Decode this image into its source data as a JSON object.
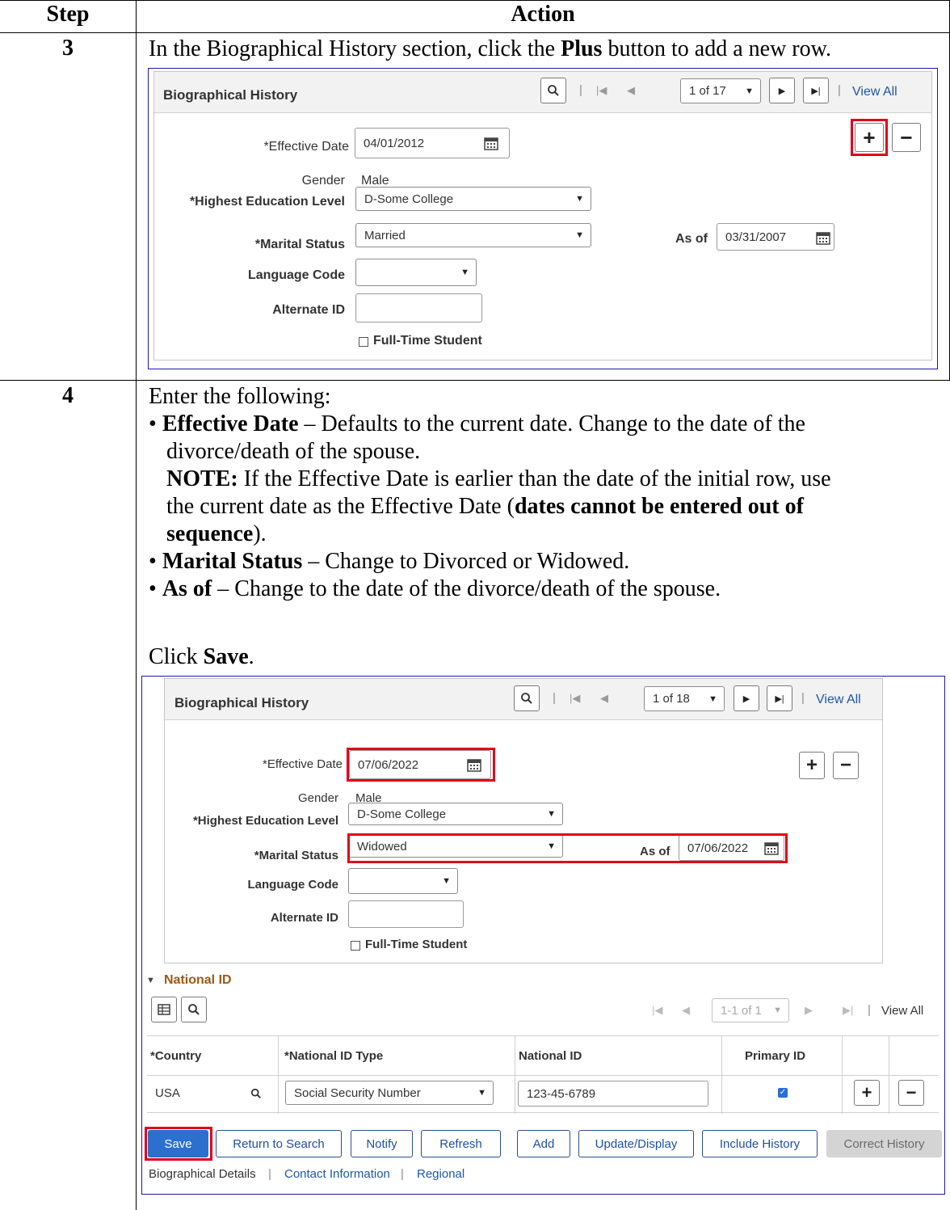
{
  "table": {
    "col_step": "Step",
    "col_action": "Action",
    "rows": [
      {
        "step": "3",
        "instruction_pre": "In the Biographical History section, click the ",
        "instruction_bold": "Plus",
        "instruction_post": " button to add a new row."
      },
      {
        "step": "4"
      }
    ]
  },
  "step4": {
    "intro": "Enter the following:",
    "b1_label": "Effective Date",
    "b1_text": " – Defaults to the current date. Change to the date of the",
    "b1_text2": "divorce/death of the spouse.",
    "note_label": "NOTE:",
    "note_text": " If the Effective Date is earlier than the date of the initial row, use",
    "note_text2": "the current date as the Effective Date (",
    "note_bold": "dates cannot be entered out of",
    "note_bold2": "sequence",
    "note_end": ").",
    "b2_label": "Marital Status",
    "b2_text": " – Change to Divorced or Widowed.",
    "b3_label": "As of",
    "b3_text": " – Change to the date of the divorce/death of the spouse.",
    "click_pre": "Click ",
    "click_bold": "Save",
    "click_end": "."
  },
  "shot1": {
    "title": "Biographical History",
    "counter": "1 of 17",
    "view_all": "View All",
    "effective_date_label": "*Effective Date",
    "effective_date": "04/01/2012",
    "gender_label": "Gender",
    "gender": "Male",
    "education_label": "*Highest Education Level",
    "education": "D-Some College",
    "marital_label": "*Marital Status",
    "marital": "Married",
    "as_of_label": "As of",
    "as_of": "03/31/2007",
    "language_label": "Language Code",
    "alternate_label": "Alternate ID",
    "fulltime_label": "Full-Time Student"
  },
  "shot2": {
    "title": "Biographical History",
    "counter": "1 of 18",
    "view_all": "View All",
    "effective_date_label": "*Effective Date",
    "effective_date": "07/06/2022",
    "gender_label": "Gender",
    "gender": "Male",
    "education_label": "*Highest Education Level",
    "education": "D-Some College",
    "marital_label": "*Marital Status",
    "marital": "Widowed",
    "as_of_label": "As of",
    "as_of": "07/06/2022",
    "language_label": "Language Code",
    "alternate_label": "Alternate ID",
    "fulltime_label": "Full-Time Student",
    "national_id_section": "National ID",
    "nid_counter": "1-1 of 1",
    "nid_view_all": "View All",
    "nid_headers": [
      "*Country",
      "*National ID Type",
      "National ID",
      "Primary ID"
    ],
    "nid_row": {
      "country": "USA",
      "type": "Social Security Number",
      "id": "123-45-6789"
    },
    "buttons": [
      "Save",
      "Return to Search",
      "Notify",
      "Refresh",
      "Add",
      "Update/Display",
      "Include History",
      "Correct History"
    ],
    "footer_links": [
      "Biographical Details",
      "Contact Information",
      "Regional"
    ]
  },
  "colors": {
    "highlight": "#e0001a",
    "save_button": "#2c6fcf",
    "link": "#1f57a6",
    "frame": "#1a1aa8"
  }
}
